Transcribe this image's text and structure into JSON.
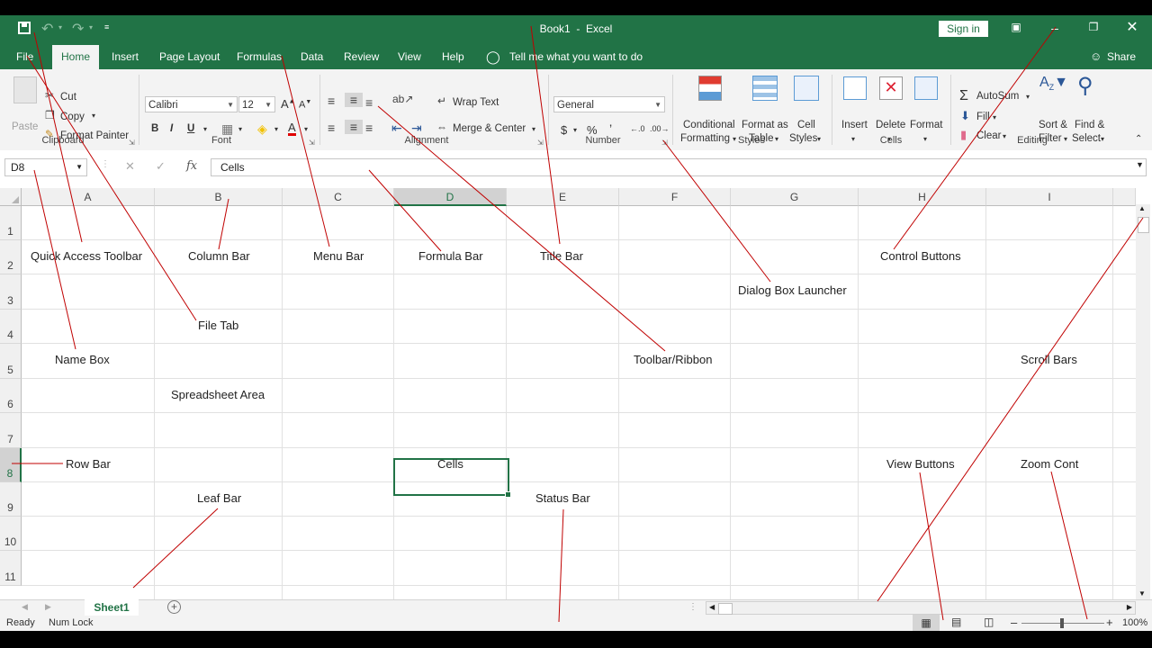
{
  "window": {
    "title": "Book1  -  Excel",
    "sign_in": "Sign in",
    "share": "Share"
  },
  "menu": {
    "file": "File",
    "tabs": [
      "Home",
      "Insert",
      "Page Layout",
      "Formulas",
      "Data",
      "Review",
      "View",
      "Help"
    ],
    "tell_me": "Tell me what you want to do"
  },
  "ribbon": {
    "clipboard": {
      "paste": "Paste",
      "cut": "Cut",
      "copy": "Copy",
      "format_painter": "Format Painter",
      "label": "Clipboard"
    },
    "font": {
      "family": "Calibri",
      "size": "12",
      "label": "Font"
    },
    "alignment": {
      "wrap_text": "Wrap Text",
      "merge_center": "Merge & Center",
      "label": "Alignment"
    },
    "number": {
      "format": "General",
      "label": "Number",
      "currency": "$",
      "percent": "%",
      "comma": "’"
    },
    "styles": {
      "conditional_1": "Conditional",
      "conditional_2": "Formatting",
      "format_table_1": "Format as",
      "format_table_2": "Table",
      "cell_styles_1": "Cell",
      "cell_styles_2": "Styles",
      "label": "Styles"
    },
    "cells": {
      "insert": "Insert",
      "delete": "Delete",
      "format": "Format",
      "label": "Cells"
    },
    "editing": {
      "autosum": "AutoSum",
      "fill": "Fill",
      "clear": "Clear",
      "sort_1": "Sort &",
      "sort_2": "Filter",
      "find_1": "Find &",
      "find_2": "Select",
      "label": "Editing"
    }
  },
  "formula_bar": {
    "name_box": "D8",
    "content": "Cells"
  },
  "grid": {
    "columns": [
      "A",
      "B",
      "C",
      "D",
      "E",
      "F",
      "G",
      "H",
      "I"
    ],
    "rows": [
      "1",
      "2",
      "3",
      "4",
      "5",
      "6",
      "7",
      "8",
      "9",
      "10",
      "11"
    ],
    "selected_column": "D",
    "selected_row": "8"
  },
  "annotations": {
    "quick_access_toolbar": "Quick Access Toolbar",
    "column_bar": "Column Bar",
    "menu_bar": "Menu Bar",
    "formula_bar": "Formula Bar",
    "title_bar": "Title Bar",
    "control_buttons": "Control Buttons",
    "dialog_box_launcher": "Dialog Box Launcher",
    "file_tab": "File Tab",
    "name_box": "Name Box",
    "toolbar_ribbon": "Toolbar/Ribbon",
    "scroll_bars": "Scroll Bars",
    "spreadsheet_area": "Spreadsheet Area",
    "row_bar": "Row Bar",
    "cells": "Cells",
    "view_buttons": "View Buttons",
    "zoom_cont": "Zoom Cont",
    "leaf_bar": "Leaf Bar",
    "status_bar": "Status Bar"
  },
  "sheets": {
    "active": "Sheet1"
  },
  "status": {
    "ready": "Ready",
    "num_lock": "Num Lock",
    "zoom": "100%"
  },
  "colors": {
    "excel_green": "#217346",
    "annotation_red": "#c00000"
  }
}
